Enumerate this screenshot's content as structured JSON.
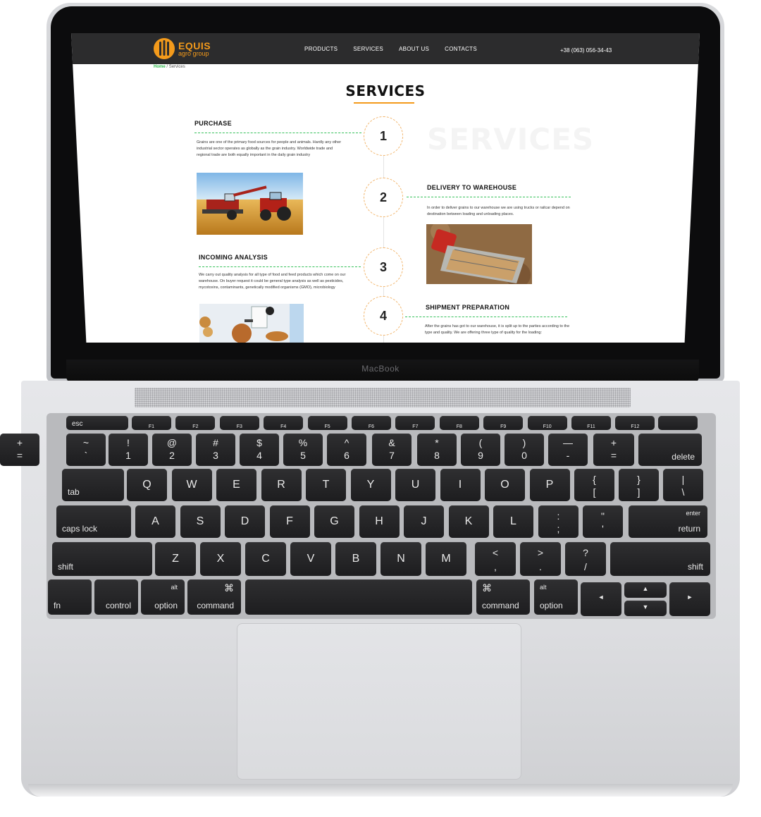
{
  "device": {
    "brand_label": "MacBook"
  },
  "site": {
    "logo": {
      "name": "EQUIS",
      "sub": "agro group"
    },
    "nav": [
      "PRODUCTS",
      "SERVICES",
      "ABOUT US",
      "CONTACTS"
    ],
    "phone": "+38 (063) 056-34-43",
    "breadcrumb": {
      "home": "Home",
      "separator": "/",
      "current": "Services"
    },
    "page_title": "SERVICES",
    "watermark": "SERVICES",
    "accent_color": "#f39a1b",
    "dash_color": "#35c05a",
    "steps": [
      {
        "number": "1",
        "title": "PURCHASE",
        "text": "Grains are one of the primary food sources for people and animals. Hardly any other industrial sector operates as globally as the grain industry. Worldwide trade and regional trade are both equally important in the daily grain industry",
        "image": "combine-harvester-field-photo"
      },
      {
        "number": "2",
        "title": "DELIVERY TO WAREHOUSE",
        "text": "In order to deliver grains to our warehouse we are using trucks or railcar depend on destination between loading and unloading places.",
        "image": "grain-truck-unloading-photo"
      },
      {
        "number": "3",
        "title": "INCOMING ANALYSIS",
        "text": "We carry out quality analysis for all type of food and feed products which come on our warehouse. On buyer request it could be general type analysis as well as pesticides, mycotoxins, contaminants, genetically modified organisms (GMO), microbiology",
        "image": "laboratory-microscope-photo"
      },
      {
        "number": "4",
        "title": "SHIPMENT PREPARATION",
        "text": "After the grains has got to our warehouse, it is split up to the parties according to the type and quality. We are offering three type of quality for the loading:",
        "image": ""
      }
    ]
  },
  "keyboard": {
    "esc": "esc",
    "fkeys": [
      "F1",
      "F2",
      "F3",
      "F4",
      "F5",
      "F6",
      "F7",
      "F8",
      "F9",
      "F10",
      "F11",
      "F12"
    ],
    "fkey_icons": [
      "brightness-down-icon",
      "brightness-up-icon",
      "mission-control-icon",
      "launchpad-icon",
      "keyboard-light-down-icon",
      "keyboard-light-up-icon",
      "rewind-icon",
      "play-pause-icon",
      "fast-forward-icon",
      "mute-icon",
      "volume-down-icon",
      "volume-up-icon"
    ],
    "number_row": [
      [
        "~",
        "`"
      ],
      [
        "!",
        "1"
      ],
      [
        "@",
        "2"
      ],
      [
        "#",
        "3"
      ],
      [
        "$",
        "4"
      ],
      [
        "%",
        "5"
      ],
      [
        "^",
        "6"
      ],
      [
        "&",
        "7"
      ],
      [
        "*",
        "8"
      ],
      [
        "(",
        "9"
      ],
      [
        ")",
        "0"
      ],
      [
        "—",
        "-"
      ],
      [
        "+",
        "="
      ]
    ],
    "delete": "delete",
    "tab": "tab",
    "qrow": [
      "Q",
      "W",
      "E",
      "R",
      "T",
      "Y",
      "U",
      "I",
      "O",
      "P"
    ],
    "qrow_brackets": [
      [
        "{",
        "["
      ],
      [
        "}",
        "]"
      ],
      [
        "|",
        "\\"
      ]
    ],
    "caps": "caps lock",
    "arow": [
      "A",
      "S",
      "D",
      "F",
      "G",
      "H",
      "J",
      "K",
      "L"
    ],
    "arow_punct": [
      [
        ":",
        ";"
      ],
      [
        "\"",
        "'"
      ]
    ],
    "enter_top": "enter",
    "enter_bottom": "return",
    "shift": "shift",
    "zrow": [
      "Z",
      "X",
      "C",
      "V",
      "B",
      "N",
      "M"
    ],
    "zrow_punct": [
      [
        "<",
        ","
      ],
      [
        ">",
        "."
      ],
      [
        "?",
        "/"
      ]
    ],
    "fn": "fn",
    "control": "control",
    "option": "option",
    "alt": "alt",
    "command": "command",
    "command_symbol": "⌘",
    "arrow_left": "◄",
    "arrow_right": "►",
    "arrow_up": "▲",
    "arrow_down": "▼"
  }
}
